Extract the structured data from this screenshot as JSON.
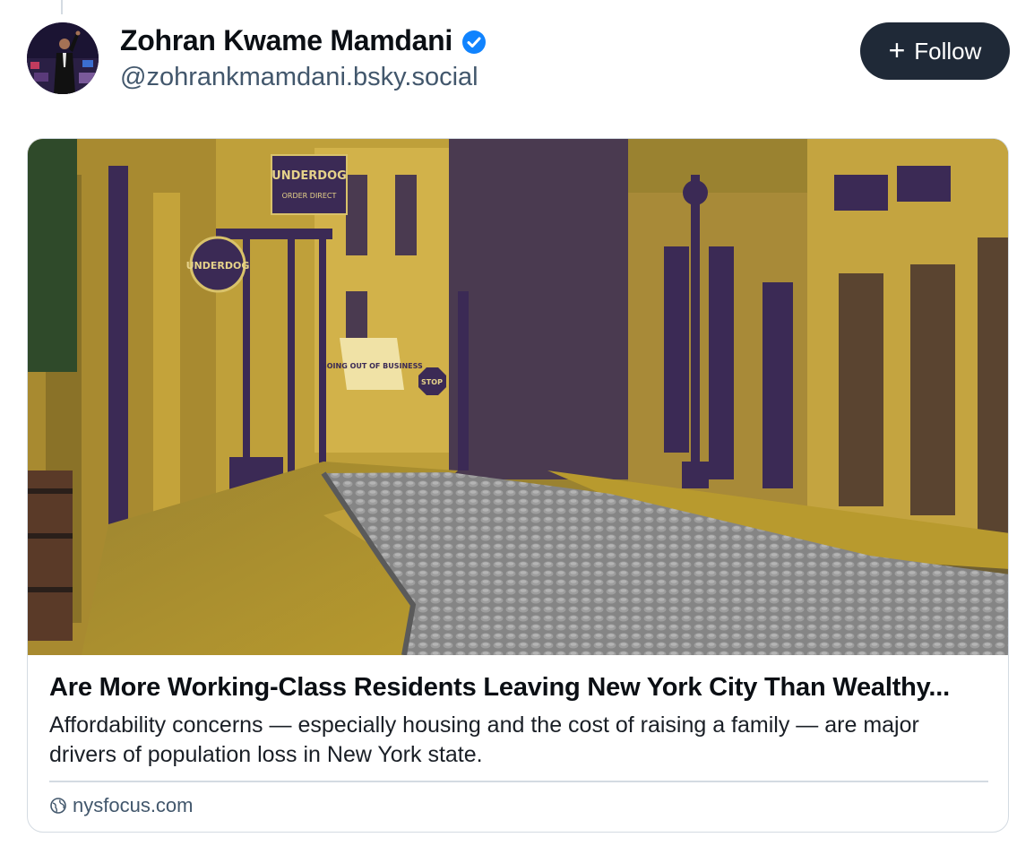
{
  "post": {
    "author_name": "Zohran Kwame Mamdani",
    "author_handle": "@zohrankmamdani.bsky.social",
    "verified": true,
    "follow_label": "Follow"
  },
  "link_card": {
    "title": "Are More Working-Class Residents Leaving New York City Than Wealthy...",
    "description": "Affordability concerns — especially housing and the cost of raising a family — are major drivers of population loss in New York state.",
    "domain": "nysfocus.com",
    "image_signs": {
      "underdog_sign": "UNDERDOG",
      "order_direct": "ORDER DIRECT",
      "going_out": "GOING OUT OF BUSINESS",
      "stop_sign": "STOP"
    }
  },
  "colors": {
    "follow_bg": "#1f2937",
    "verified_blue": "#1083fe",
    "handle_gray": "#42576c",
    "border": "#d4dbe2",
    "image_gold": "#b89a2e",
    "image_purple": "#3b2a55"
  },
  "icons": {
    "verified": "verified-badge-icon",
    "plus": "plus-icon",
    "globe": "globe-icon"
  }
}
